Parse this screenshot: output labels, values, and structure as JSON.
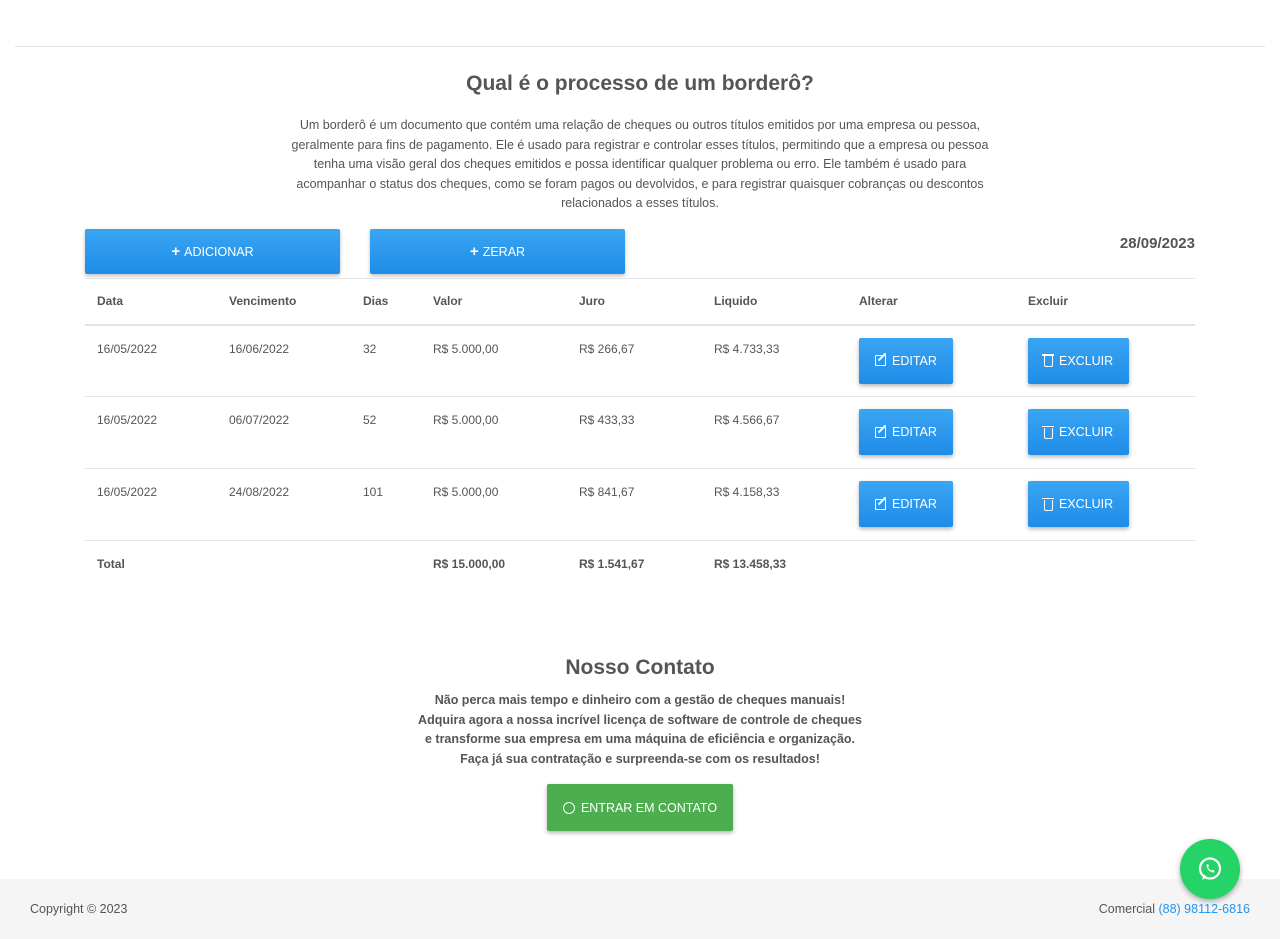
{
  "intro": {
    "title": "Qual é o processo de um borderô?",
    "paragraph": "Um borderô é um documento que contém uma relação de cheques ou outros títulos emitidos por uma empresa ou pessoa, geralmente para fins de pagamento. Ele é usado para registrar e controlar esses títulos, permitindo que a empresa ou pessoa tenha uma visão geral dos cheques emitidos e possa identificar qualquer problema ou erro. Ele também é usado para acompanhar o status dos cheques, como se foram pagos ou devolvidos, e para registrar quaisquer cobranças ou descontos relacionados a esses títulos."
  },
  "toolbar": {
    "add_label": "ADICIONAR",
    "reset_label": "ZERAR",
    "date": "28/09/2023"
  },
  "table": {
    "headers": [
      "Data",
      "Vencimento",
      "Dias",
      "Valor",
      "Juro",
      "Liquido",
      "Alterar",
      "Excluir"
    ],
    "rows": [
      [
        "16/05/2022",
        "16/06/2022",
        "32",
        "R$ 5.000,00",
        "R$ 266,67",
        "R$ 4.733,33"
      ],
      [
        "16/05/2022",
        "06/07/2022",
        "52",
        "R$ 5.000,00",
        "R$ 433,33",
        "R$ 4.566,67"
      ],
      [
        "16/05/2022",
        "24/08/2022",
        "101",
        "R$ 5.000,00",
        "R$ 841,67",
        "R$ 4.158,33"
      ]
    ],
    "edit_label": "EDITAR",
    "delete_label": "EXCLUIR",
    "total": {
      "label": "Total",
      "valor": "R$ 15.000,00",
      "juro": "R$ 1.541,67",
      "liquido": "R$ 13.458,33"
    }
  },
  "contact": {
    "title": "Nosso Contato",
    "lines": [
      "Não perca mais tempo e dinheiro com a gestão de cheques manuais!",
      "Adquira agora a nossa incrível licença de software de controle de cheques",
      "e transforme sua empresa em uma máquina de eficiência e organização.",
      "Faça já sua contratação e surpreenda-se com os resultados!"
    ],
    "button_label": "ENTRAR EM CONTATO"
  },
  "footer": {
    "copyright": "Copyright © 2023",
    "commercial_label": "Comercial",
    "phone": "(88) 98112-6816"
  },
  "colors": {
    "primary": "#2196f3",
    "success": "#4cae4f",
    "whatsapp": "#25d366"
  }
}
